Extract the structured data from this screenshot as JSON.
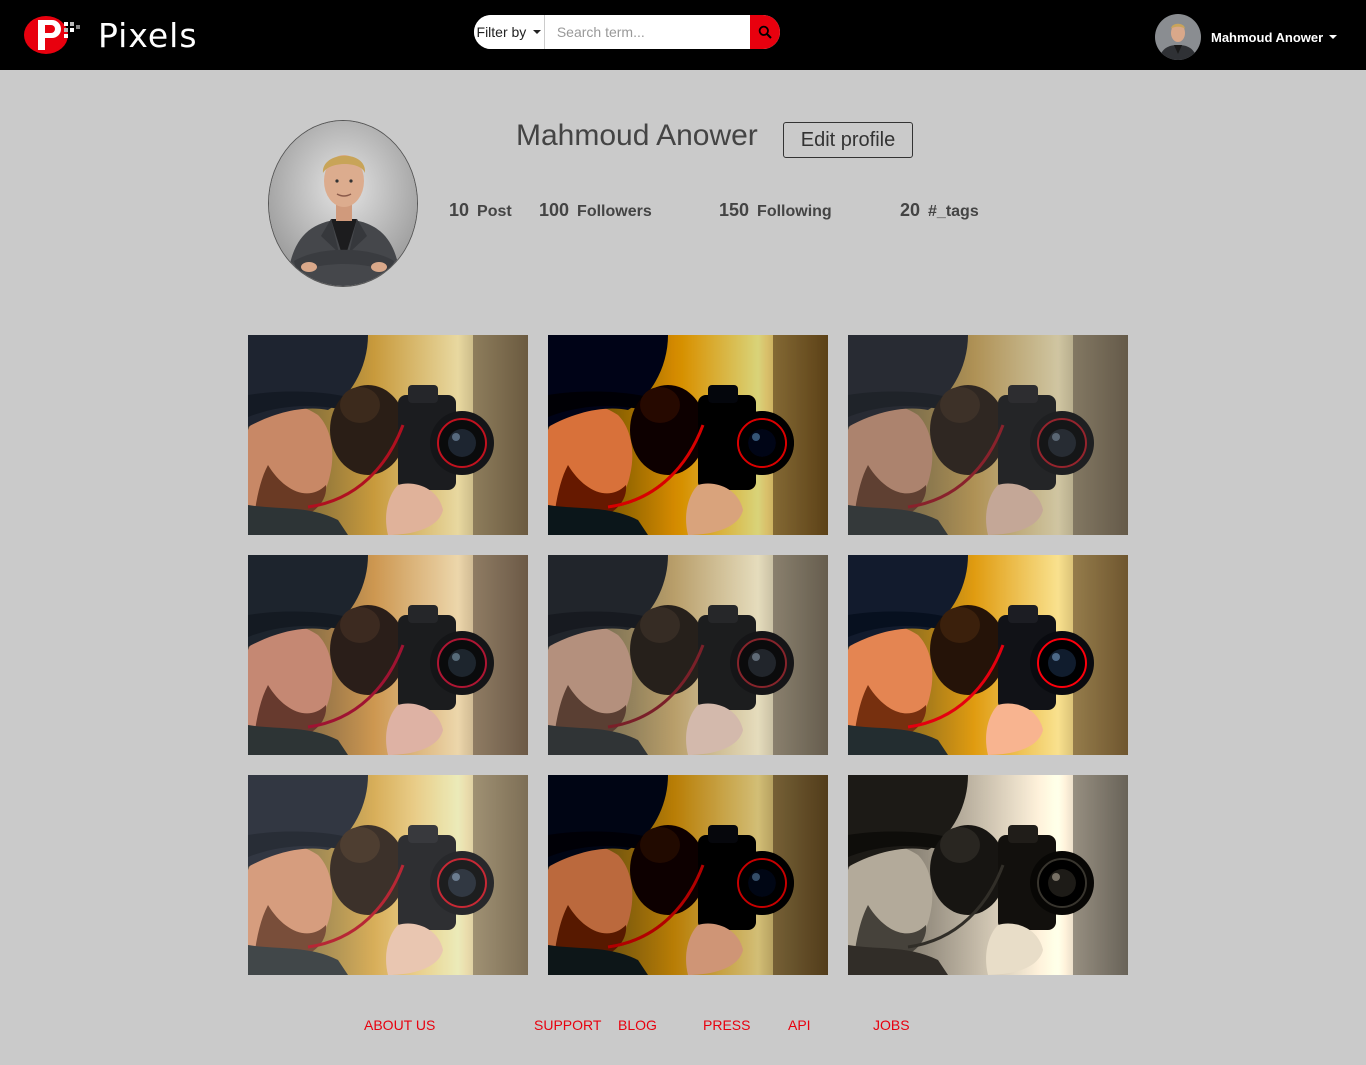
{
  "brand": {
    "name": "Pixels",
    "accent": "#e8000e",
    "topbar_bg": "#000000"
  },
  "search": {
    "filter_label": "Filter by",
    "placeholder": "Search term...",
    "button_icon": "search-icon"
  },
  "user_menu": {
    "name": "Mahmoud Anower",
    "icon": "chevron-down-icon"
  },
  "profile": {
    "name": "Mahmoud Anower",
    "edit_label": "Edit profile",
    "stats": [
      {
        "value": "10",
        "label": "Post"
      },
      {
        "value": "100",
        "label": "Followers"
      },
      {
        "value": "150",
        "label": "Following"
      },
      {
        "value": "20",
        "label": "#_tags"
      }
    ]
  },
  "gallery": {
    "filters": [
      "original",
      "warm-contrast",
      "faded",
      "cool",
      "muted",
      "vivid",
      "light",
      "dark",
      "sepia"
    ]
  },
  "footer": {
    "links": [
      "ABOUT US",
      "SUPPORT",
      "BLOG",
      "PRESS",
      "API",
      "JOBS"
    ]
  }
}
